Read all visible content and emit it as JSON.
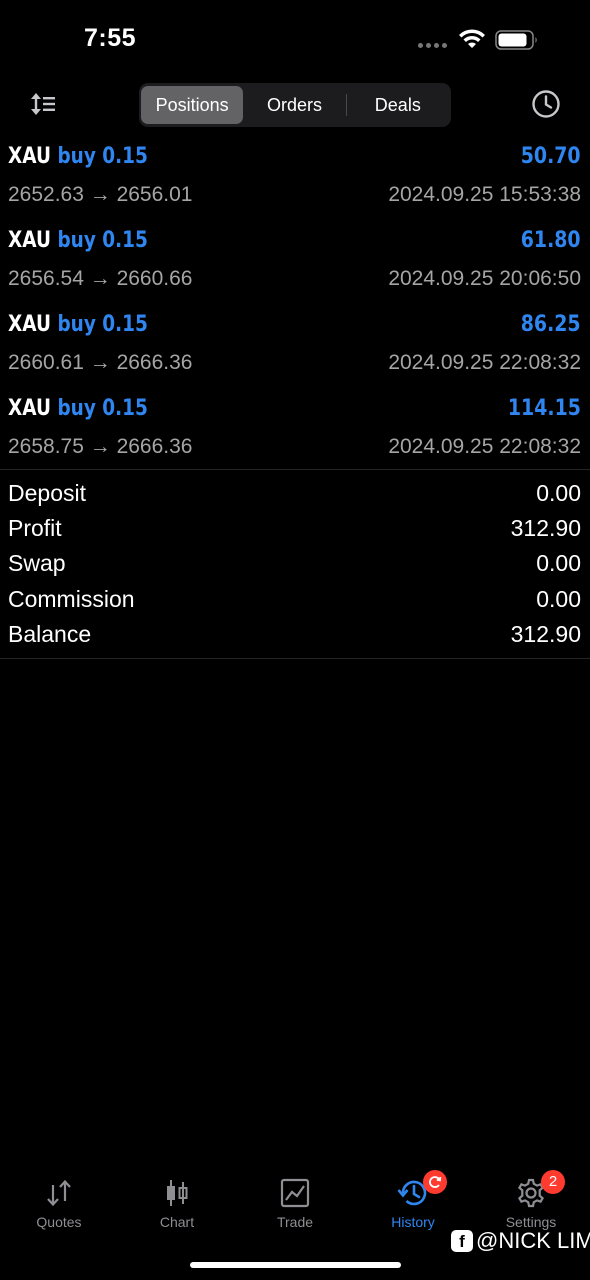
{
  "status_bar": {
    "time": "7:55"
  },
  "toolbar": {
    "tabs": [
      {
        "label": "Positions",
        "active": true
      },
      {
        "label": "Orders",
        "active": false
      },
      {
        "label": "Deals",
        "active": false
      }
    ],
    "left_icon": "sort-icon",
    "right_icon": "clock-history-icon"
  },
  "positions": [
    {
      "symbol": "XAU",
      "side": "buy 0.15",
      "profit": "50.70",
      "prices": "2652.63 → 2656.01",
      "time": "2024.09.25 15:53:38"
    },
    {
      "symbol": "XAU",
      "side": "buy 0.15",
      "profit": "61.80",
      "prices": "2656.54 → 2660.66",
      "time": "2024.09.25 20:06:50"
    },
    {
      "symbol": "XAU",
      "side": "buy 0.15",
      "profit": "86.25",
      "prices": "2660.61 → 2666.36",
      "time": "2024.09.25 22:08:32"
    },
    {
      "symbol": "XAU",
      "side": "buy 0.15",
      "profit": "114.15",
      "prices": "2658.75 → 2666.36",
      "time": "2024.09.25 22:08:32"
    }
  ],
  "summary": [
    {
      "label": "Deposit",
      "value": "0.00"
    },
    {
      "label": "Profit",
      "value": "312.90"
    },
    {
      "label": "Swap",
      "value": "0.00"
    },
    {
      "label": "Commission",
      "value": "0.00"
    },
    {
      "label": "Balance",
      "value": "312.90"
    }
  ],
  "tabbar": {
    "items": [
      {
        "label": "Quotes",
        "icon": "quotes-arrows-icon",
        "active": false
      },
      {
        "label": "Chart",
        "icon": "candlestick-icon",
        "active": false
      },
      {
        "label": "Trade",
        "icon": "trade-chart-icon",
        "active": false
      },
      {
        "label": "History",
        "icon": "history-icon",
        "active": true
      },
      {
        "label": "Settings",
        "icon": "gear-icon",
        "active": false,
        "badge": "2"
      }
    ]
  },
  "watermark": {
    "text": "@NICK LIM",
    "icon": "facebook-icon",
    "icon_glyph": "f"
  },
  "colors": {
    "background": "#000000",
    "accent_blue": "#2f86f0",
    "secondary_text": "#a5a5a5",
    "badge_red": "#ff3b30"
  }
}
